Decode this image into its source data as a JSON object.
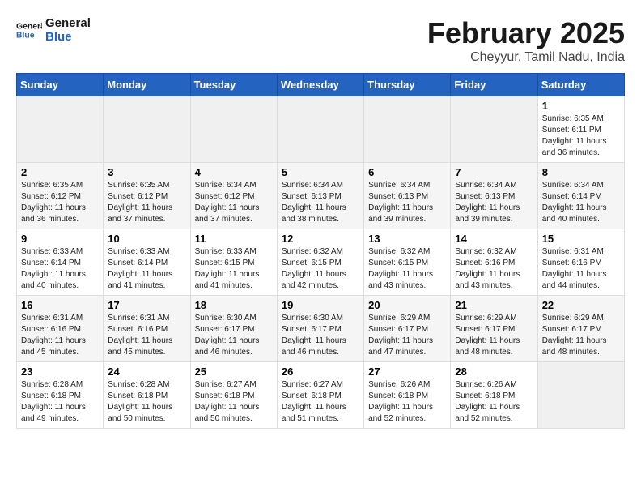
{
  "header": {
    "logo_line1": "General",
    "logo_line2": "Blue",
    "title": "February 2025",
    "subtitle": "Cheyyur, Tamil Nadu, India"
  },
  "days_of_week": [
    "Sunday",
    "Monday",
    "Tuesday",
    "Wednesday",
    "Thursday",
    "Friday",
    "Saturday"
  ],
  "weeks": [
    [
      {
        "day": "",
        "info": ""
      },
      {
        "day": "",
        "info": ""
      },
      {
        "day": "",
        "info": ""
      },
      {
        "day": "",
        "info": ""
      },
      {
        "day": "",
        "info": ""
      },
      {
        "day": "",
        "info": ""
      },
      {
        "day": "1",
        "info": "Sunrise: 6:35 AM\nSunset: 6:11 PM\nDaylight: 11 hours\nand 36 minutes."
      }
    ],
    [
      {
        "day": "2",
        "info": "Sunrise: 6:35 AM\nSunset: 6:12 PM\nDaylight: 11 hours\nand 36 minutes."
      },
      {
        "day": "3",
        "info": "Sunrise: 6:35 AM\nSunset: 6:12 PM\nDaylight: 11 hours\nand 37 minutes."
      },
      {
        "day": "4",
        "info": "Sunrise: 6:34 AM\nSunset: 6:12 PM\nDaylight: 11 hours\nand 37 minutes."
      },
      {
        "day": "5",
        "info": "Sunrise: 6:34 AM\nSunset: 6:13 PM\nDaylight: 11 hours\nand 38 minutes."
      },
      {
        "day": "6",
        "info": "Sunrise: 6:34 AM\nSunset: 6:13 PM\nDaylight: 11 hours\nand 39 minutes."
      },
      {
        "day": "7",
        "info": "Sunrise: 6:34 AM\nSunset: 6:13 PM\nDaylight: 11 hours\nand 39 minutes."
      },
      {
        "day": "8",
        "info": "Sunrise: 6:34 AM\nSunset: 6:14 PM\nDaylight: 11 hours\nand 40 minutes."
      }
    ],
    [
      {
        "day": "9",
        "info": "Sunrise: 6:33 AM\nSunset: 6:14 PM\nDaylight: 11 hours\nand 40 minutes."
      },
      {
        "day": "10",
        "info": "Sunrise: 6:33 AM\nSunset: 6:14 PM\nDaylight: 11 hours\nand 41 minutes."
      },
      {
        "day": "11",
        "info": "Sunrise: 6:33 AM\nSunset: 6:15 PM\nDaylight: 11 hours\nand 41 minutes."
      },
      {
        "day": "12",
        "info": "Sunrise: 6:32 AM\nSunset: 6:15 PM\nDaylight: 11 hours\nand 42 minutes."
      },
      {
        "day": "13",
        "info": "Sunrise: 6:32 AM\nSunset: 6:15 PM\nDaylight: 11 hours\nand 43 minutes."
      },
      {
        "day": "14",
        "info": "Sunrise: 6:32 AM\nSunset: 6:16 PM\nDaylight: 11 hours\nand 43 minutes."
      },
      {
        "day": "15",
        "info": "Sunrise: 6:31 AM\nSunset: 6:16 PM\nDaylight: 11 hours\nand 44 minutes."
      }
    ],
    [
      {
        "day": "16",
        "info": "Sunrise: 6:31 AM\nSunset: 6:16 PM\nDaylight: 11 hours\nand 45 minutes."
      },
      {
        "day": "17",
        "info": "Sunrise: 6:31 AM\nSunset: 6:16 PM\nDaylight: 11 hours\nand 45 minutes."
      },
      {
        "day": "18",
        "info": "Sunrise: 6:30 AM\nSunset: 6:17 PM\nDaylight: 11 hours\nand 46 minutes."
      },
      {
        "day": "19",
        "info": "Sunrise: 6:30 AM\nSunset: 6:17 PM\nDaylight: 11 hours\nand 46 minutes."
      },
      {
        "day": "20",
        "info": "Sunrise: 6:29 AM\nSunset: 6:17 PM\nDaylight: 11 hours\nand 47 minutes."
      },
      {
        "day": "21",
        "info": "Sunrise: 6:29 AM\nSunset: 6:17 PM\nDaylight: 11 hours\nand 48 minutes."
      },
      {
        "day": "22",
        "info": "Sunrise: 6:29 AM\nSunset: 6:17 PM\nDaylight: 11 hours\nand 48 minutes."
      }
    ],
    [
      {
        "day": "23",
        "info": "Sunrise: 6:28 AM\nSunset: 6:18 PM\nDaylight: 11 hours\nand 49 minutes."
      },
      {
        "day": "24",
        "info": "Sunrise: 6:28 AM\nSunset: 6:18 PM\nDaylight: 11 hours\nand 50 minutes."
      },
      {
        "day": "25",
        "info": "Sunrise: 6:27 AM\nSunset: 6:18 PM\nDaylight: 11 hours\nand 50 minutes."
      },
      {
        "day": "26",
        "info": "Sunrise: 6:27 AM\nSunset: 6:18 PM\nDaylight: 11 hours\nand 51 minutes."
      },
      {
        "day": "27",
        "info": "Sunrise: 6:26 AM\nSunset: 6:18 PM\nDaylight: 11 hours\nand 52 minutes."
      },
      {
        "day": "28",
        "info": "Sunrise: 6:26 AM\nSunset: 6:18 PM\nDaylight: 11 hours\nand 52 minutes."
      },
      {
        "day": "",
        "info": ""
      }
    ]
  ]
}
